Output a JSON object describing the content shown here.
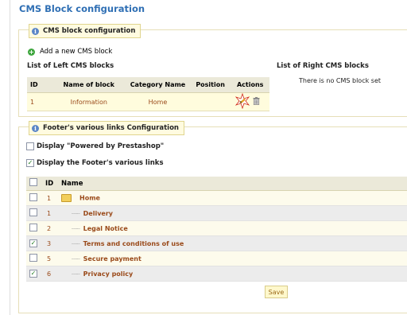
{
  "page": {
    "title": "CMS Block configuration"
  },
  "cms_section": {
    "legend": "CMS block configuration",
    "add_label": "Add a new CMS block",
    "left_title": "List of Left CMS blocks",
    "right_title": "List of Right CMS blocks",
    "right_empty": "There is no CMS block set",
    "columns": [
      "ID",
      "Name of block",
      "Category Name",
      "Position",
      "Actions"
    ],
    "rows": [
      {
        "id": "1",
        "name": "Information",
        "category": "Home",
        "position": ""
      }
    ]
  },
  "footer_section": {
    "legend": "Footer's various links Configuration",
    "powered_label": "Display \"Powered by Prestashop\"",
    "powered_checked": false,
    "links_label": "Display the Footer's various links",
    "links_checked": true,
    "columns": [
      "ID",
      "Name"
    ],
    "rows": [
      {
        "id": "1",
        "name": "Home",
        "checked": false,
        "root": true
      },
      {
        "id": "1",
        "name": "Delivery",
        "checked": false,
        "root": false
      },
      {
        "id": "2",
        "name": "Legal Notice",
        "checked": false,
        "root": false
      },
      {
        "id": "3",
        "name": "Terms and conditions of use",
        "checked": true,
        "root": false
      },
      {
        "id": "5",
        "name": "Secure payment",
        "checked": false,
        "root": false
      },
      {
        "id": "6",
        "name": "Privacy policy",
        "checked": true,
        "root": false
      }
    ],
    "save_label": "Save"
  },
  "colors": {
    "title_blue": "#2f6fb4",
    "link_brown": "#9a4a1a",
    "legend_bg": "#fffbe0"
  }
}
